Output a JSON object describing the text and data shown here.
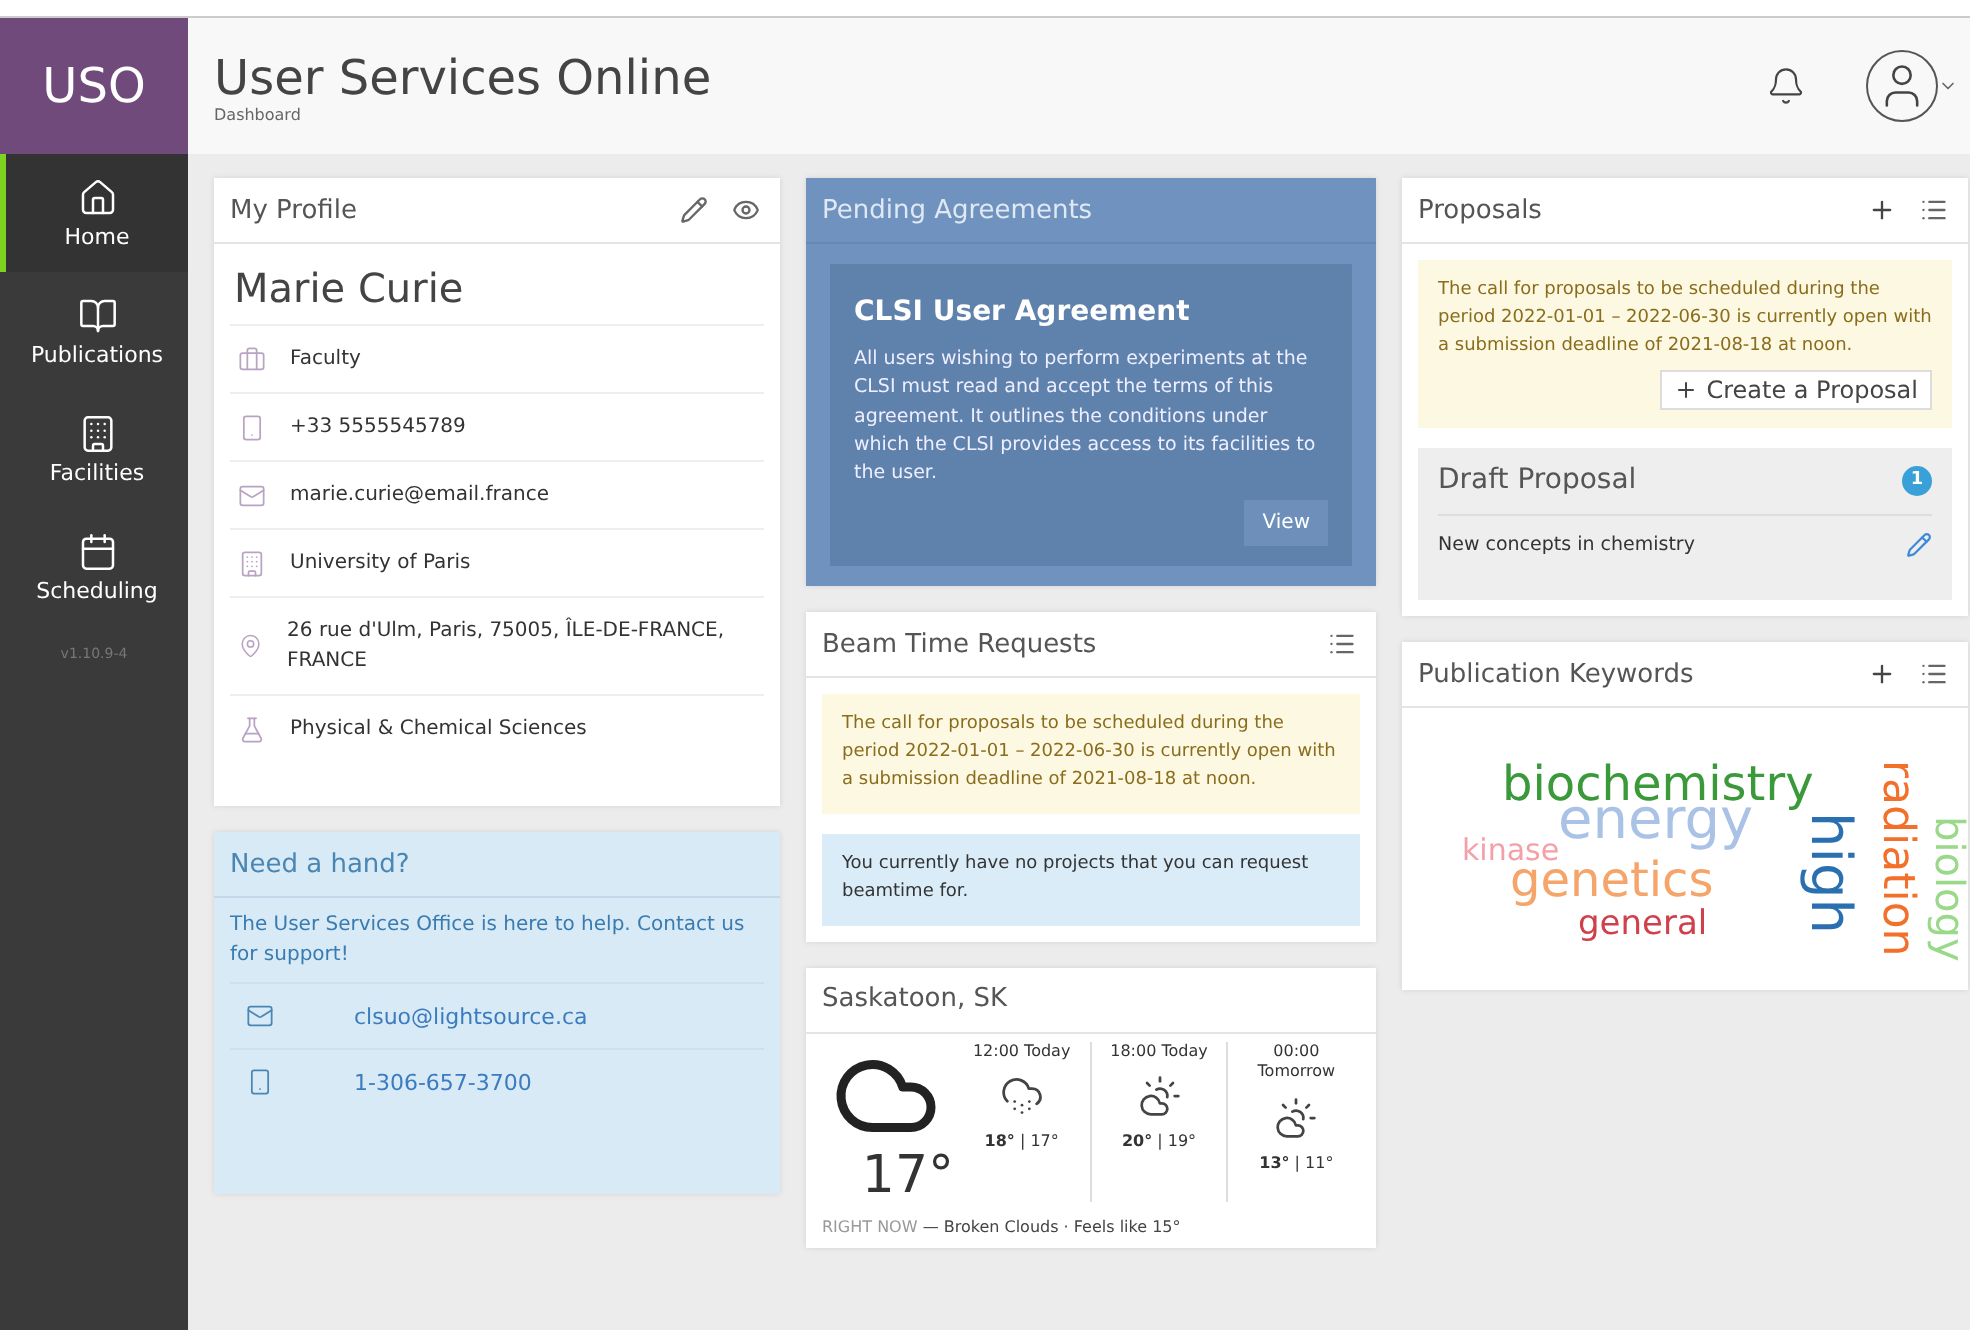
{
  "brand": "USO",
  "app_title": "User Services Online",
  "breadcrumb": "Dashboard",
  "sidebar": {
    "items": [
      {
        "label": "Home",
        "selected": true
      },
      {
        "label": "Publications",
        "selected": false
      },
      {
        "label": "Facilities",
        "selected": false
      },
      {
        "label": "Scheduling",
        "selected": false
      }
    ],
    "version": "v1.10.9-4"
  },
  "profile": {
    "title": "My Profile",
    "name": "Marie Curie",
    "fields": [
      "Faculty",
      "+33 5555545789",
      "marie.curie@email.france",
      "University of Paris",
      "26 rue d'Ulm, Paris, 75005, ÎLE-DE-FRANCE, FRANCE",
      "Physical & Chemical Sciences"
    ]
  },
  "help": {
    "title": "Need a hand?",
    "text": "The User Services Office is here to help. Contact us for support!",
    "contacts": [
      "clsuo@lightsource.ca",
      "1-306-657-3700"
    ]
  },
  "agreements": {
    "title": "Pending Agreements",
    "heading": "CLSI User Agreement",
    "text": "All users wishing to perform experiments at the CLSI must read and accept the terms of this agreement. It outlines the conditions under which the CLSI provides access to its facilities to the user.",
    "button": "View"
  },
  "beamtime": {
    "title": "Beam Time Requests",
    "notices": [
      {
        "kind": "warning",
        "text": "The call for proposals to be scheduled during the period 2022-01-01 – 2022-06-30 is currently open with a submission deadline of 2021-08-18 at noon."
      },
      {
        "kind": "info",
        "text": "You currently have no projects that you can request beamtime for."
      }
    ]
  },
  "weather": {
    "title": "Saskatoon, SK",
    "now_temp": "17°",
    "forecast": [
      {
        "time": "12:00 Today",
        "kind": "snow",
        "temps": "**18°** | 17°"
      },
      {
        "time": "18:00 Today",
        "kind": "cloudy",
        "temps": "**20°** | 19°"
      },
      {
        "time": "00:00 Tomorrow",
        "kind": "cloudy",
        "temps": "**13°** | 11°"
      }
    ],
    "now_label": "RIGHT NOW",
    "now_text": "— Broken Clouds · Feels like 15°"
  },
  "proposals": {
    "title": "Proposals",
    "notice": "The call for proposals to be scheduled during the period 2022-01-01 – 2022-06-30 is currently open with a submission deadline of 2021-08-18 at noon.",
    "create_button": "Create a Proposal",
    "draft": {
      "title": "Draft Proposal",
      "count": "1",
      "items": [
        "New concepts in chemistry"
      ]
    }
  },
  "keywords": {
    "title": "Publication Keywords",
    "words": [
      {
        "text": "biochemistry",
        "color": "#3a9a3a",
        "vertical": false
      },
      {
        "text": "energy",
        "color": "#a9c2e6",
        "vertical": false
      },
      {
        "text": "kinase",
        "color": "#f4a0a8",
        "vertical": false
      },
      {
        "text": "genetics",
        "color": "#f6a56a",
        "vertical": false
      },
      {
        "text": "general",
        "color": "#d0404a",
        "vertical": false
      },
      {
        "text": "high",
        "color": "#2a6fb0",
        "vertical": true
      },
      {
        "text": "radiation",
        "color": "#f2702a",
        "vertical": true
      },
      {
        "text": "biology",
        "color": "#9ad88a",
        "vertical": true
      }
    ]
  }
}
